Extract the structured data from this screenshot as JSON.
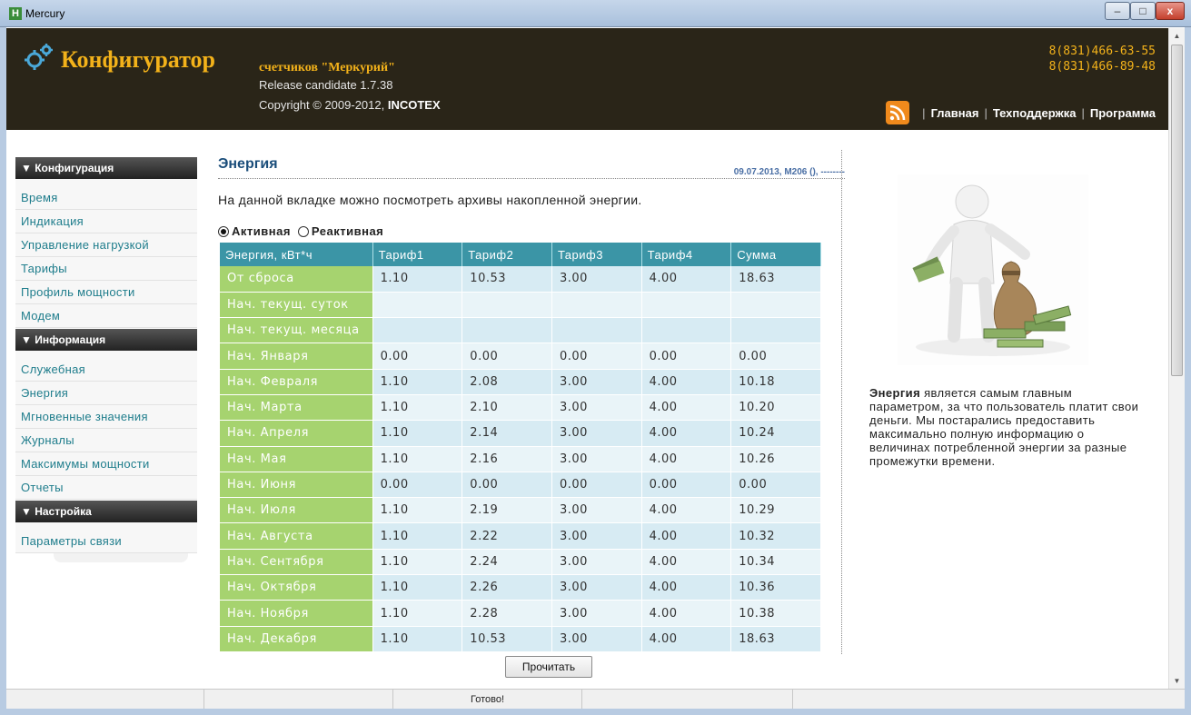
{
  "window": {
    "title": "Mercury",
    "app_icon": "H",
    "minimize": "–",
    "maximize": "□",
    "close": "x"
  },
  "header": {
    "brand": "Конфигуратор",
    "brand_sub": "счетчиков \"Меркурий\"",
    "release": "Release candidate 1.7.38",
    "copyright_prefix": "Copyright © 2009-2012,",
    "copyright_company": "INCOTEX",
    "phones": [
      "8(831)466-63-55",
      "8(831)466-89-48"
    ],
    "nav": [
      "Главная",
      "Техподдержка",
      "Программа"
    ],
    "nav_sep": "|",
    "logo_icon": "gears-icon",
    "rss_icon": "rss-icon",
    "brand_color": "#f3b21a"
  },
  "sidebar": {
    "sections": [
      {
        "label": "▼ Конфигурация",
        "items": [
          "Время",
          "Индикация",
          "Управление нагрузкой",
          "Тарифы",
          "Профиль мощности",
          "Модем"
        ]
      },
      {
        "label": "▼ Информация",
        "items": [
          "Служебная",
          "Энергия",
          "Мгновенные значения",
          "Журналы",
          "Максимумы мощности",
          "Отчеты"
        ]
      },
      {
        "label": "▼ Настройка",
        "items": [
          "Параметры связи"
        ]
      }
    ]
  },
  "main": {
    "title": "Энергия",
    "meta": "09.07.2013, M206 (), --------",
    "description": "На данной вкладке можно посмотреть архивы накопленной энергии.",
    "radio_active": "Активная",
    "radio_reactive": "Реактивная",
    "table": {
      "headers": [
        "Энергия, кВт*ч",
        "Тариф1",
        "Тариф2",
        "Тариф3",
        "Тариф4",
        "Сумма"
      ],
      "rows": [
        [
          "От сброса",
          "1.10",
          "10.53",
          "3.00",
          "4.00",
          "18.63"
        ],
        [
          "Нач. текущ. суток",
          "",
          "",
          "",
          "",
          ""
        ],
        [
          "Нач. текущ. месяца",
          "",
          "",
          "",
          "",
          ""
        ],
        [
          "Нач. Января",
          "0.00",
          "0.00",
          "0.00",
          "0.00",
          "0.00"
        ],
        [
          "Нач. Февраля",
          "1.10",
          "2.08",
          "3.00",
          "4.00",
          "10.18"
        ],
        [
          "Нач. Марта",
          "1.10",
          "2.10",
          "3.00",
          "4.00",
          "10.20"
        ],
        [
          "Нач. Апреля",
          "1.10",
          "2.14",
          "3.00",
          "4.00",
          "10.24"
        ],
        [
          "Нач. Мая",
          "1.10",
          "2.16",
          "3.00",
          "4.00",
          "10.26"
        ],
        [
          "Нач. Июня",
          "0.00",
          "0.00",
          "0.00",
          "0.00",
          "0.00"
        ],
        [
          "Нач. Июля",
          "1.10",
          "2.19",
          "3.00",
          "4.00",
          "10.29"
        ],
        [
          "Нач. Августа",
          "1.10",
          "2.22",
          "3.00",
          "4.00",
          "10.32"
        ],
        [
          "Нач. Сентября",
          "1.10",
          "2.24",
          "3.00",
          "4.00",
          "10.34"
        ],
        [
          "Нач. Октября",
          "1.10",
          "2.26",
          "3.00",
          "4.00",
          "10.36"
        ],
        [
          "Нач. Ноября",
          "1.10",
          "2.28",
          "3.00",
          "4.00",
          "10.38"
        ],
        [
          "Нач. Декабря",
          "1.10",
          "10.53",
          "3.00",
          "4.00",
          "18.63"
        ]
      ]
    },
    "read_button": "Прочитать",
    "header_color": "#3b95a6",
    "rowhead_color": "#a6d36f"
  },
  "info": {
    "bold": "Энергия",
    "text": " является самым главным параметром, за что пользователь платит свои деньги. Мы постарались предоставить максимально полную информацию о величинах потребленной энергии за разные промежутки времени."
  },
  "statusbar": {
    "status": "Готово!"
  }
}
